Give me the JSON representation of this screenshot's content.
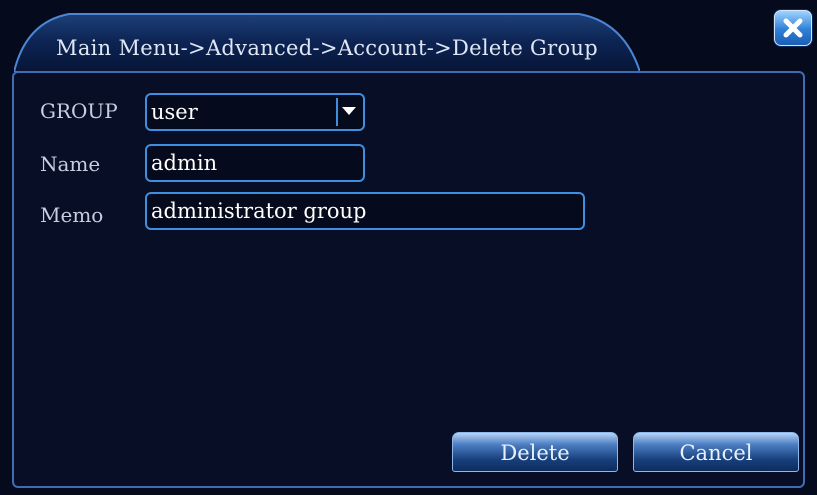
{
  "window": {
    "title": "Main Menu->Advanced->Account->Delete Group"
  },
  "form": {
    "group_label": "GROUP",
    "group_value": "user",
    "name_label": "Name",
    "name_value": "admin",
    "memo_label": "Memo",
    "memo_value": "administrator group"
  },
  "actions": {
    "delete_label": "Delete",
    "cancel_label": "Cancel"
  },
  "icons": {
    "close": "close-icon",
    "dropdown": "dropdown-arrow-icon"
  },
  "colors": {
    "background": "#050b1c",
    "border_accent": "#3f8fe0",
    "close_button": "#2f7fd6"
  }
}
